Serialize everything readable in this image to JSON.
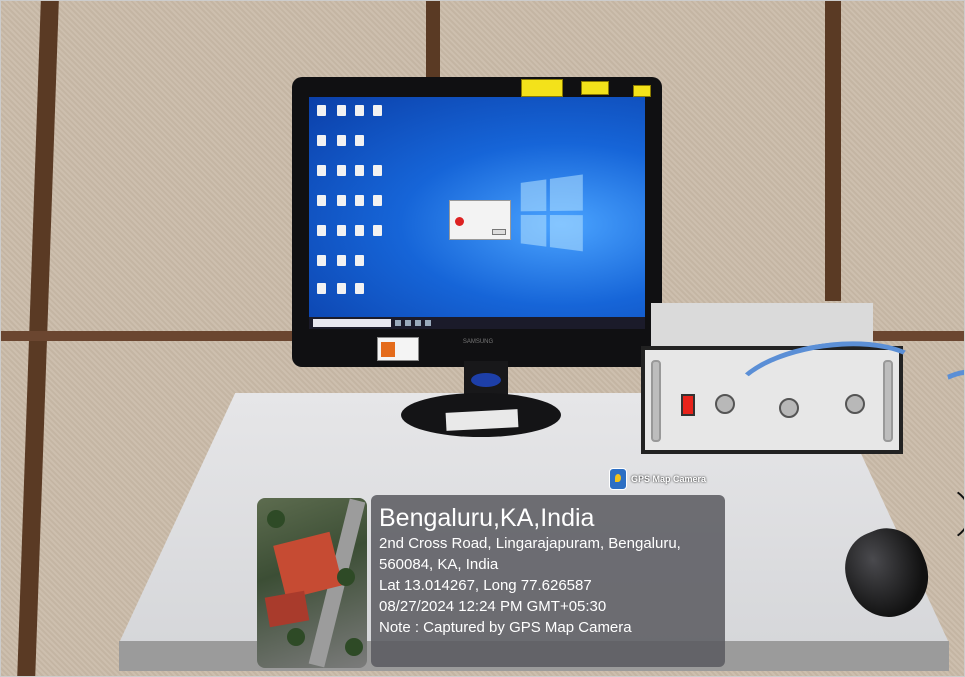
{
  "overlay": {
    "app_tag": "GPS Map Camera",
    "location_title": "Bengaluru,KA,India",
    "address_line1": "2nd Cross Road, Lingarajapuram, Bengaluru,",
    "address_line2": "560084, KA, India",
    "coordinates": "Lat 13.014267, Long 77.626587",
    "timestamp": "08/27/2024 12:24 PM GMT+05:30",
    "note": "Note : Captured by GPS Map Camera"
  },
  "monitor": {
    "brand": "SAMSUNG"
  },
  "colors": {
    "wall": "#c9bba9",
    "wood_frame": "#5a3a24",
    "desk": "#e0e1e3",
    "screen_blue": "#1665d8",
    "power_switch": "#e8231b",
    "cable": "#5b8fd6",
    "overlay_panel": "#5a5a5f"
  }
}
